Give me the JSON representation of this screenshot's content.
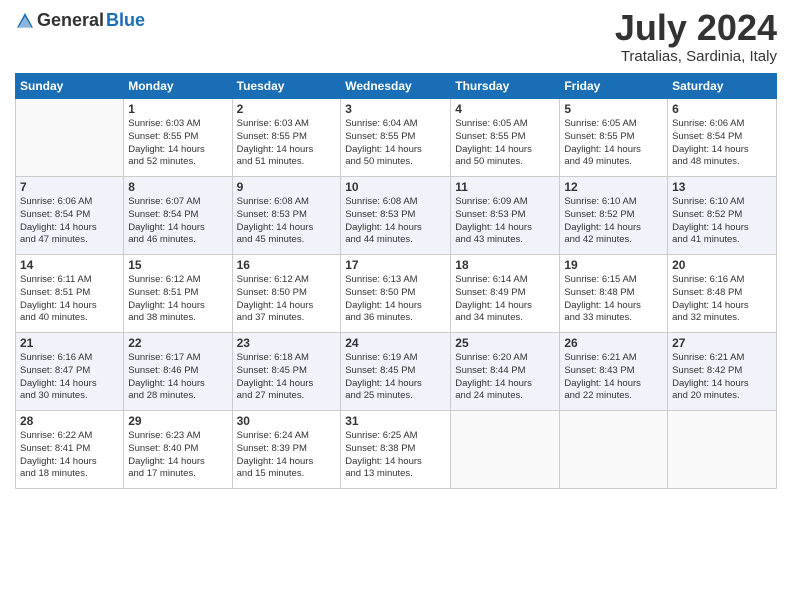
{
  "header": {
    "logo": {
      "general": "General",
      "blue": "Blue"
    },
    "title": "July 2024",
    "location": "Tratalias, Sardinia, Italy"
  },
  "weekdays": [
    "Sunday",
    "Monday",
    "Tuesday",
    "Wednesday",
    "Thursday",
    "Friday",
    "Saturday"
  ],
  "weeks": [
    [
      {
        "day": "",
        "sunrise": "",
        "sunset": "",
        "daylight": ""
      },
      {
        "day": "1",
        "sunrise": "Sunrise: 6:03 AM",
        "sunset": "Sunset: 8:55 PM",
        "daylight": "Daylight: 14 hours and 52 minutes."
      },
      {
        "day": "2",
        "sunrise": "Sunrise: 6:03 AM",
        "sunset": "Sunset: 8:55 PM",
        "daylight": "Daylight: 14 hours and 51 minutes."
      },
      {
        "day": "3",
        "sunrise": "Sunrise: 6:04 AM",
        "sunset": "Sunset: 8:55 PM",
        "daylight": "Daylight: 14 hours and 50 minutes."
      },
      {
        "day": "4",
        "sunrise": "Sunrise: 6:05 AM",
        "sunset": "Sunset: 8:55 PM",
        "daylight": "Daylight: 14 hours and 50 minutes."
      },
      {
        "day": "5",
        "sunrise": "Sunrise: 6:05 AM",
        "sunset": "Sunset: 8:55 PM",
        "daylight": "Daylight: 14 hours and 49 minutes."
      },
      {
        "day": "6",
        "sunrise": "Sunrise: 6:06 AM",
        "sunset": "Sunset: 8:54 PM",
        "daylight": "Daylight: 14 hours and 48 minutes."
      }
    ],
    [
      {
        "day": "7",
        "sunrise": "Sunrise: 6:06 AM",
        "sunset": "Sunset: 8:54 PM",
        "daylight": "Daylight: 14 hours and 47 minutes."
      },
      {
        "day": "8",
        "sunrise": "Sunrise: 6:07 AM",
        "sunset": "Sunset: 8:54 PM",
        "daylight": "Daylight: 14 hours and 46 minutes."
      },
      {
        "day": "9",
        "sunrise": "Sunrise: 6:08 AM",
        "sunset": "Sunset: 8:53 PM",
        "daylight": "Daylight: 14 hours and 45 minutes."
      },
      {
        "day": "10",
        "sunrise": "Sunrise: 6:08 AM",
        "sunset": "Sunset: 8:53 PM",
        "daylight": "Daylight: 14 hours and 44 minutes."
      },
      {
        "day": "11",
        "sunrise": "Sunrise: 6:09 AM",
        "sunset": "Sunset: 8:53 PM",
        "daylight": "Daylight: 14 hours and 43 minutes."
      },
      {
        "day": "12",
        "sunrise": "Sunrise: 6:10 AM",
        "sunset": "Sunset: 8:52 PM",
        "daylight": "Daylight: 14 hours and 42 minutes."
      },
      {
        "day": "13",
        "sunrise": "Sunrise: 6:10 AM",
        "sunset": "Sunset: 8:52 PM",
        "daylight": "Daylight: 14 hours and 41 minutes."
      }
    ],
    [
      {
        "day": "14",
        "sunrise": "Sunrise: 6:11 AM",
        "sunset": "Sunset: 8:51 PM",
        "daylight": "Daylight: 14 hours and 40 minutes."
      },
      {
        "day": "15",
        "sunrise": "Sunrise: 6:12 AM",
        "sunset": "Sunset: 8:51 PM",
        "daylight": "Daylight: 14 hours and 38 minutes."
      },
      {
        "day": "16",
        "sunrise": "Sunrise: 6:12 AM",
        "sunset": "Sunset: 8:50 PM",
        "daylight": "Daylight: 14 hours and 37 minutes."
      },
      {
        "day": "17",
        "sunrise": "Sunrise: 6:13 AM",
        "sunset": "Sunset: 8:50 PM",
        "daylight": "Daylight: 14 hours and 36 minutes."
      },
      {
        "day": "18",
        "sunrise": "Sunrise: 6:14 AM",
        "sunset": "Sunset: 8:49 PM",
        "daylight": "Daylight: 14 hours and 34 minutes."
      },
      {
        "day": "19",
        "sunrise": "Sunrise: 6:15 AM",
        "sunset": "Sunset: 8:48 PM",
        "daylight": "Daylight: 14 hours and 33 minutes."
      },
      {
        "day": "20",
        "sunrise": "Sunrise: 6:16 AM",
        "sunset": "Sunset: 8:48 PM",
        "daylight": "Daylight: 14 hours and 32 minutes."
      }
    ],
    [
      {
        "day": "21",
        "sunrise": "Sunrise: 6:16 AM",
        "sunset": "Sunset: 8:47 PM",
        "daylight": "Daylight: 14 hours and 30 minutes."
      },
      {
        "day": "22",
        "sunrise": "Sunrise: 6:17 AM",
        "sunset": "Sunset: 8:46 PM",
        "daylight": "Daylight: 14 hours and 28 minutes."
      },
      {
        "day": "23",
        "sunrise": "Sunrise: 6:18 AM",
        "sunset": "Sunset: 8:45 PM",
        "daylight": "Daylight: 14 hours and 27 minutes."
      },
      {
        "day": "24",
        "sunrise": "Sunrise: 6:19 AM",
        "sunset": "Sunset: 8:45 PM",
        "daylight": "Daylight: 14 hours and 25 minutes."
      },
      {
        "day": "25",
        "sunrise": "Sunrise: 6:20 AM",
        "sunset": "Sunset: 8:44 PM",
        "daylight": "Daylight: 14 hours and 24 minutes."
      },
      {
        "day": "26",
        "sunrise": "Sunrise: 6:21 AM",
        "sunset": "Sunset: 8:43 PM",
        "daylight": "Daylight: 14 hours and 22 minutes."
      },
      {
        "day": "27",
        "sunrise": "Sunrise: 6:21 AM",
        "sunset": "Sunset: 8:42 PM",
        "daylight": "Daylight: 14 hours and 20 minutes."
      }
    ],
    [
      {
        "day": "28",
        "sunrise": "Sunrise: 6:22 AM",
        "sunset": "Sunset: 8:41 PM",
        "daylight": "Daylight: 14 hours and 18 minutes."
      },
      {
        "day": "29",
        "sunrise": "Sunrise: 6:23 AM",
        "sunset": "Sunset: 8:40 PM",
        "daylight": "Daylight: 14 hours and 17 minutes."
      },
      {
        "day": "30",
        "sunrise": "Sunrise: 6:24 AM",
        "sunset": "Sunset: 8:39 PM",
        "daylight": "Daylight: 14 hours and 15 minutes."
      },
      {
        "day": "31",
        "sunrise": "Sunrise: 6:25 AM",
        "sunset": "Sunset: 8:38 PM",
        "daylight": "Daylight: 14 hours and 13 minutes."
      },
      {
        "day": "",
        "sunrise": "",
        "sunset": "",
        "daylight": ""
      },
      {
        "day": "",
        "sunrise": "",
        "sunset": "",
        "daylight": ""
      },
      {
        "day": "",
        "sunrise": "",
        "sunset": "",
        "daylight": ""
      }
    ]
  ]
}
